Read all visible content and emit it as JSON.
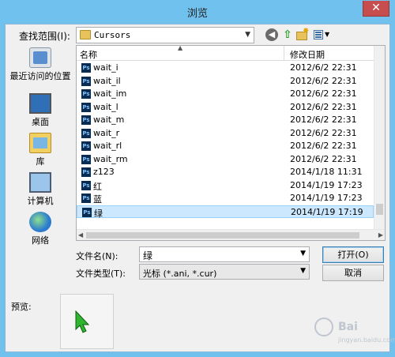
{
  "window": {
    "title": "浏览",
    "close_glyph": "✕"
  },
  "lookin": {
    "label": "查找范围(I):",
    "value": "Cursors"
  },
  "places": [
    {
      "label": "最近访问的位置"
    },
    {
      "label": "桌面"
    },
    {
      "label": "库"
    },
    {
      "label": "计算机"
    },
    {
      "label": "网络"
    }
  ],
  "columns": {
    "name": "名称",
    "date": "修改日期"
  },
  "files": [
    {
      "name": "wait_i",
      "date": "2012/6/2 22:31"
    },
    {
      "name": "wait_il",
      "date": "2012/6/2 22:31"
    },
    {
      "name": "wait_im",
      "date": "2012/6/2 22:31"
    },
    {
      "name": "wait_l",
      "date": "2012/6/2 22:31"
    },
    {
      "name": "wait_m",
      "date": "2012/6/2 22:31"
    },
    {
      "name": "wait_r",
      "date": "2012/6/2 22:31"
    },
    {
      "name": "wait_rl",
      "date": "2012/6/2 22:31"
    },
    {
      "name": "wait_rm",
      "date": "2012/6/2 22:31"
    },
    {
      "name": "z123",
      "date": "2014/1/18 11:31"
    },
    {
      "name": "红",
      "date": "2014/1/19 17:23"
    },
    {
      "name": "蓝",
      "date": "2014/1/19 17:23"
    },
    {
      "name": "绿",
      "date": "2014/1/19 17:19"
    }
  ],
  "selected_file_index": 11,
  "filename": {
    "label": "文件名(N):",
    "value": "绿"
  },
  "filetype": {
    "label": "文件类型(T):",
    "value": "光标 (*.ani, *.cur)"
  },
  "buttons": {
    "open": "打开(O)",
    "cancel": "取消"
  },
  "preview": {
    "label": "预览:"
  },
  "watermark": {
    "text1": "Bai",
    "text2": "jingyan.baidu.com"
  },
  "colors": {
    "titlebar": "#71c1ef",
    "close": "#c74e4e",
    "selection": "#cce8ff",
    "cursor": "#2fb52f"
  }
}
